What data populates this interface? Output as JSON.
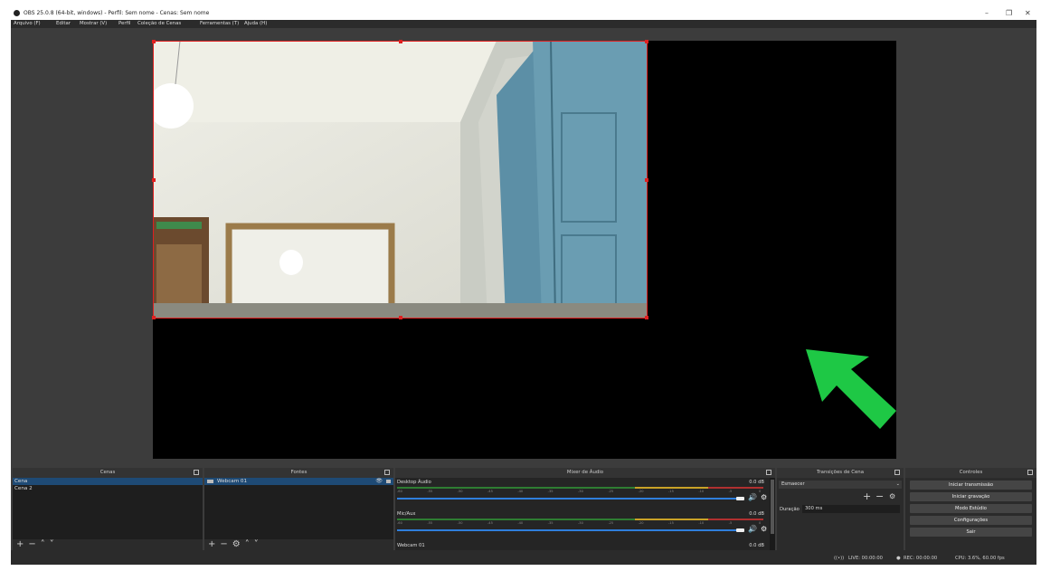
{
  "window": {
    "title": "OBS 25.0.8 (64-bit, windows) - Perfil: Sem nome - Cenas: Sem nome"
  },
  "menu": [
    "Arquivo (F)",
    "Editar",
    "Mostrar (V)",
    "Perfil",
    "Coleção de Cenas",
    "Ferramentas (T)",
    "Ajuda (H)"
  ],
  "scenes": {
    "title": "Cenas",
    "items": [
      "Cena",
      "Cena 2"
    ]
  },
  "sources": {
    "title": "Fontes",
    "items": [
      "Webcam 01"
    ]
  },
  "mixer": {
    "title": "Mixer de Áudio",
    "channels": [
      {
        "name": "Desktop Áudio",
        "db": "0.0 dB"
      },
      {
        "name": "Mic/Aux",
        "db": "0.0 dB"
      },
      {
        "name": "Webcam 01",
        "db": "0.0 dB"
      }
    ],
    "ticks": [
      "-60",
      "-55",
      "-50",
      "-45",
      "-40",
      "-35",
      "-30",
      "-25",
      "-20",
      "-15",
      "-10",
      "-5",
      "0"
    ]
  },
  "transitions": {
    "title": "Transições de Cena",
    "selected": "Esmaecer",
    "duration_label": "Duração",
    "duration_value": "300 ms"
  },
  "controls": {
    "title": "Controles",
    "buttons": [
      "Iniciar transmissão",
      "Iniciar gravação",
      "Modo Estúdio",
      "Configurações",
      "Sair"
    ]
  },
  "status": {
    "live": "LIVE: 00:00:00",
    "rec": "REC: 00:00:00",
    "cpu": "CPU: 3.6%, 60.00 fps"
  },
  "colors": {
    "selection": "#e02020",
    "arrow": "#1ec845",
    "accent": "#2f7fdc"
  }
}
